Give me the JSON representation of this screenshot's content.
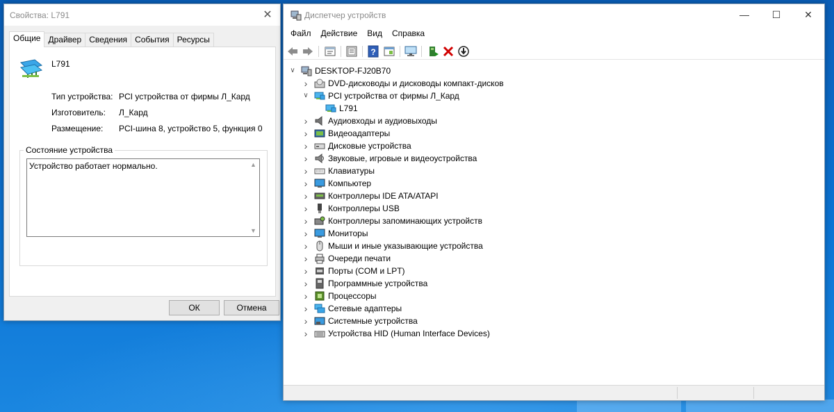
{
  "properties_dialog": {
    "title": "Свойства: L791",
    "tabs": [
      "Общие",
      "Драйвер",
      "Сведения",
      "События",
      "Ресурсы"
    ],
    "device_name": "L791",
    "props": [
      {
        "label": "Тип устройства:",
        "value": "PCI устройства от фирмы Л_Кард"
      },
      {
        "label": "Изготовитель:",
        "value": "Л_Кард"
      },
      {
        "label": "Размещение:",
        "value": "PCI-шина 8, устройство 5, функция 0"
      }
    ],
    "status_group_title": "Состояние устройства",
    "status_text": "Устройство работает нормально.",
    "ok_label": "ОК",
    "cancel_label": "Отмена",
    "close_glyph": "✕"
  },
  "device_manager": {
    "title": "Диспетчер устройств",
    "menu": [
      "Файл",
      "Действие",
      "Вид",
      "Справка"
    ],
    "root": "DESKTOP-FJ20B70",
    "tree": [
      {
        "label": "DVD-дисководы и дисководы компакт-дисков",
        "icon": "dvd-icon",
        "expanded": false
      },
      {
        "label": "PCI устройства от фирмы Л_Кард",
        "icon": "network-card-icon",
        "expanded": true,
        "children": [
          {
            "label": "L791",
            "icon": "network-card-icon"
          }
        ]
      },
      {
        "label": "Аудиовходы и аудиовыходы",
        "icon": "speaker-icon",
        "expanded": false
      },
      {
        "label": "Видеоадаптеры",
        "icon": "display-adapter-icon",
        "expanded": false
      },
      {
        "label": "Дисковые устройства",
        "icon": "disk-drive-icon",
        "expanded": false
      },
      {
        "label": "Звуковые, игровые и видеоустройства",
        "icon": "sound-icon",
        "expanded": false
      },
      {
        "label": "Клавиатуры",
        "icon": "keyboard-icon",
        "expanded": false
      },
      {
        "label": "Компьютер",
        "icon": "computer-icon",
        "expanded": false
      },
      {
        "label": "Контроллеры IDE ATA/ATAPI",
        "icon": "ide-controller-icon",
        "expanded": false
      },
      {
        "label": "Контроллеры USB",
        "icon": "usb-icon",
        "expanded": false
      },
      {
        "label": "Контроллеры запоминающих устройств",
        "icon": "storage-controller-icon",
        "expanded": false
      },
      {
        "label": "Мониторы",
        "icon": "monitor-icon",
        "expanded": false
      },
      {
        "label": "Мыши и иные указывающие устройства",
        "icon": "mouse-icon",
        "expanded": false
      },
      {
        "label": "Очереди печати",
        "icon": "printer-icon",
        "expanded": false
      },
      {
        "label": "Порты (COM и LPT)",
        "icon": "port-icon",
        "expanded": false
      },
      {
        "label": "Программные устройства",
        "icon": "software-device-icon",
        "expanded": false
      },
      {
        "label": "Процессоры",
        "icon": "processor-icon",
        "expanded": false
      },
      {
        "label": "Сетевые адаптеры",
        "icon": "network-adapter-icon",
        "expanded": false
      },
      {
        "label": "Системные устройства",
        "icon": "system-device-icon",
        "expanded": false
      },
      {
        "label": "Устройства HID (Human Interface Devices)",
        "icon": "hid-icon",
        "expanded": false
      }
    ],
    "toolbar_icons": [
      "back-icon",
      "forward-icon",
      "properties-sheet-icon",
      "show-hidden-icon",
      "help-icon",
      "device-view-icon",
      "scan-hardware-icon",
      "add-driver-icon",
      "uninstall-icon",
      "update-driver-icon"
    ],
    "colors": {
      "accent": "#0078d7",
      "remove": "#d00000"
    }
  }
}
